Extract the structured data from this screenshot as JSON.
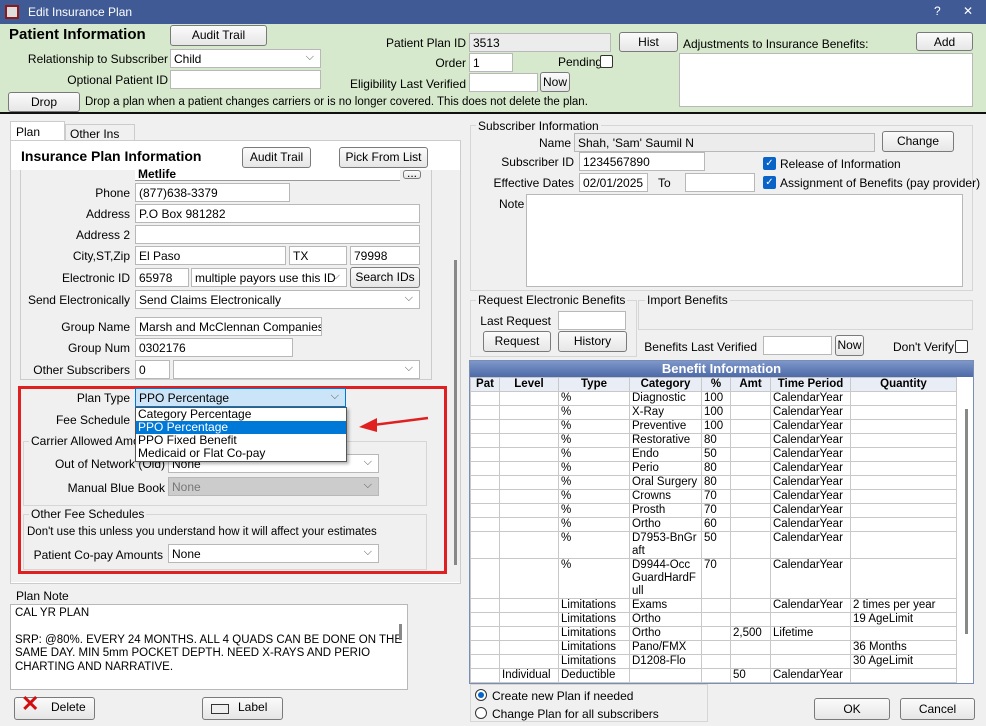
{
  "window": {
    "title": "Edit Insurance Plan",
    "help": "?",
    "close": "✕"
  },
  "patient": {
    "heading": "Patient Information",
    "audit_trail": "Audit Trail",
    "relationship_label": "Relationship to Subscriber",
    "relationship_value": "Child",
    "optional_id_label": "Optional Patient ID",
    "optional_id_value": "",
    "drop": "Drop",
    "drop_note": "Drop a plan when a patient changes carriers or is no longer covered.  This does not delete the plan.",
    "plan_id_label": "Patient Plan ID",
    "plan_id_value": "3513",
    "hist": "Hist",
    "order_label": "Order",
    "order_value": "1",
    "pending_label": "Pending",
    "elig_label": "Eligibility Last Verified",
    "elig_value": "",
    "now": "Now",
    "adjust_label": "Adjustments to Insurance Benefits:",
    "add": "Add"
  },
  "tabs": [
    "Plan Info",
    "Other Ins Info"
  ],
  "plan": {
    "heading": "Insurance Plan Information",
    "audit_trail": "Audit Trail",
    "pick": "Pick From List",
    "carrier_partial": "Metlife",
    "phone_label": "Phone",
    "phone": "(877)638-3379",
    "address_label": "Address",
    "address": "P.O Box 981282",
    "address2_label": "Address 2",
    "address2": "",
    "city_label": "City,ST,Zip",
    "city": "El Paso",
    "state": "TX",
    "zip": "79998",
    "eid_label": "Electronic ID",
    "eid": "65978",
    "eid_select": "multiple payors use this ID",
    "search_ids": "Search IDs",
    "send_label": "Send Electronically",
    "send": "Send Claims Electronically",
    "group_name_label": "Group Name",
    "group_name": "Marsh and McClennan Companies",
    "group_num_label": "Group Num",
    "group_num": "0302176",
    "other_subs_label": "Other Subscribers",
    "other_subs": "0",
    "plan_type_label": "Plan Type",
    "plan_type": "PPO Percentage",
    "plan_type_options": [
      "Category Percentage",
      "PPO Percentage",
      "PPO Fixed Benefit",
      "Medicaid or Flat Co-pay"
    ],
    "fee_label": "Fee Schedule",
    "carrier_group": "Carrier Allowed Amounts",
    "oon_label": "Out of Network (Old)",
    "oon": "None",
    "blue_label": "Manual Blue Book",
    "blue": "None",
    "other_group": "Other Fee Schedules",
    "warning": "Don't use this unless you understand how it will affect your estimates",
    "copay_label": "Patient Co-pay Amounts",
    "copay": "None"
  },
  "note": {
    "label": "Plan Note",
    "lines": [
      "CAL YR PLAN",
      "",
      "SRP: @80%. EVERY 24 MONTHS. ALL 4 QUADS CAN BE DONE ON THE",
      "SAME DAY. MIN 5mm POCKET DEPTH. NEED X-RAYS AND PERIO",
      "CHARTING AND NARRATIVE."
    ]
  },
  "bottom": {
    "delete": "Delete",
    "label": "Label",
    "ok": "OK",
    "cancel": "Cancel",
    "radio_create": "Create new Plan if needed",
    "radio_change": "Change Plan for all subscribers"
  },
  "subscriber": {
    "group": "Subscriber Information",
    "name_label": "Name",
    "name": "Shah, 'Sam' Saumil N",
    "change": "Change",
    "id_label": "Subscriber ID",
    "id": "1234567890",
    "release": "Release of Information",
    "eff_label": "Effective Dates",
    "eff_from": "02/01/2025",
    "to_label": "To",
    "eff_to": "",
    "assign": "Assignment of Benefits (pay provider)",
    "note_label": "Note"
  },
  "electronic": {
    "group": "Request Electronic Benefits",
    "last_label": "Last Request",
    "last": "",
    "request": "Request",
    "history": "History",
    "import_group": "Import Benefits",
    "verified_label": "Benefits Last Verified",
    "verified": "",
    "now": "Now",
    "dont_verify": "Don't Verify"
  },
  "benefits": {
    "title": "Benefit Information",
    "columns": [
      "Pat",
      "Level",
      "Type",
      "Category",
      "%",
      "Amt",
      "Time Period",
      "Quantity"
    ],
    "rows": [
      [
        "",
        "",
        "%",
        "Diagnostic",
        "100",
        "",
        "CalendarYear",
        ""
      ],
      [
        "",
        "",
        "%",
        "X-Ray",
        "100",
        "",
        "CalendarYear",
        ""
      ],
      [
        "",
        "",
        "%",
        "Preventive",
        "100",
        "",
        "CalendarYear",
        ""
      ],
      [
        "",
        "",
        "%",
        "Restorative",
        "80",
        "",
        "CalendarYear",
        ""
      ],
      [
        "",
        "",
        "%",
        "Endo",
        "50",
        "",
        "CalendarYear",
        ""
      ],
      [
        "",
        "",
        "%",
        "Perio",
        "80",
        "",
        "CalendarYear",
        ""
      ],
      [
        "",
        "",
        "%",
        "Oral Surgery",
        "80",
        "",
        "CalendarYear",
        ""
      ],
      [
        "",
        "",
        "%",
        "Crowns",
        "70",
        "",
        "CalendarYear",
        ""
      ],
      [
        "",
        "",
        "%",
        "Prosth",
        "70",
        "",
        "CalendarYear",
        ""
      ],
      [
        "",
        "",
        "%",
        "Ortho",
        "60",
        "",
        "CalendarYear",
        ""
      ],
      [
        "",
        "",
        "%",
        "D7953-BnGraft",
        "50",
        "",
        "CalendarYear",
        ""
      ],
      [
        "",
        "",
        "%",
        "D9944-OccGuardHardFull",
        "70",
        "",
        "CalendarYear",
        ""
      ],
      [
        "",
        "",
        "Limitations",
        "Exams",
        "",
        "",
        "CalendarYear",
        "2 times per year"
      ],
      [
        "",
        "",
        "Limitations",
        "Ortho",
        "",
        "",
        "",
        "19 AgeLimit"
      ],
      [
        "",
        "",
        "Limitations",
        "Ortho",
        "",
        "2,500",
        "Lifetime",
        ""
      ],
      [
        "",
        "",
        "Limitations",
        "Pano/FMX",
        "",
        "",
        "",
        "36 Months"
      ],
      [
        "",
        "",
        "Limitations",
        "D1208-Flo",
        "",
        "",
        "",
        "30 AgeLimit"
      ],
      [
        "",
        "Individual",
        "Deductible",
        "",
        "",
        "50",
        "CalendarYear",
        ""
      ]
    ]
  },
  "colors": {
    "title_bar": "#3f5a95",
    "patient_panel": "#d7e9cc",
    "highlight_box": "#e02020",
    "selection": "#0078d7"
  }
}
